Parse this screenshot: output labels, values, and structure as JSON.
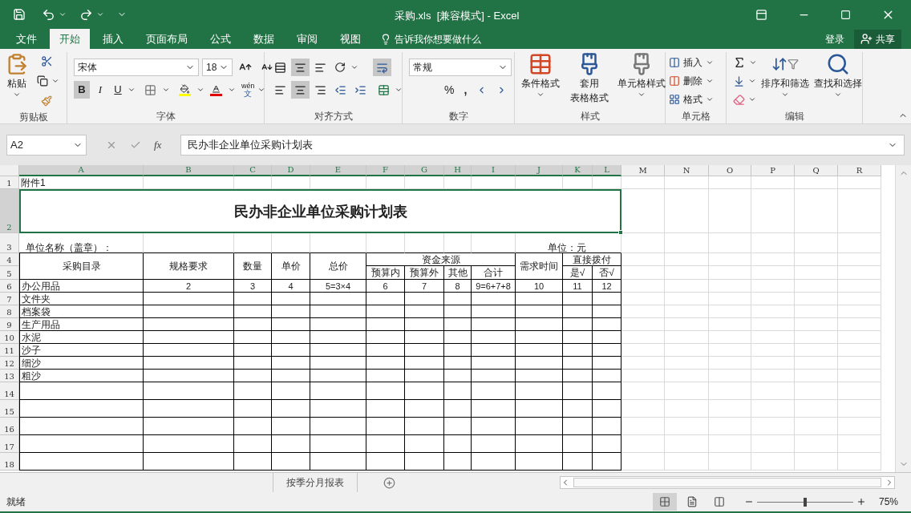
{
  "title_bar": {
    "title": "采购.xls  [兼容模式] - Excel"
  },
  "menu_tabs": [
    {
      "label": "文件",
      "selected": false
    },
    {
      "label": "开始",
      "selected": true
    },
    {
      "label": "插入",
      "selected": false
    },
    {
      "label": "页面布局",
      "selected": false
    },
    {
      "label": "公式",
      "selected": false
    },
    {
      "label": "数据",
      "selected": false
    },
    {
      "label": "审阅",
      "selected": false
    },
    {
      "label": "视图",
      "selected": false
    }
  ],
  "tell_me": "告诉我你想要做什么",
  "sign_in": "登录",
  "share": "共享",
  "ribbon": {
    "clipboard": {
      "paste": "粘贴",
      "group": "剪贴板"
    },
    "font": {
      "name": "宋体",
      "size": "18",
      "bold": "B",
      "italic": "I",
      "underline": "U",
      "phonetic": [
        "wén",
        "文"
      ],
      "group": "字体"
    },
    "alignment": {
      "group": "对齐方式"
    },
    "number": {
      "format": "常规",
      "percent": "%",
      "comma": ",",
      "group": "数字"
    },
    "styles": {
      "conditional": "条件格式",
      "table_format": [
        "套用",
        "表格格式"
      ],
      "cell_styles": "单元格样式",
      "group": "样式"
    },
    "cells": {
      "insert": "插入",
      "delete": "删除",
      "format": "格式",
      "group": "单元格"
    },
    "editing": {
      "sort_filter": "排序和筛选",
      "find_select": "查找和选择",
      "group": "编辑"
    }
  },
  "formula_bar": {
    "name_box": "A2",
    "fx": "fx",
    "content": "民办非企业单位采购计划表"
  },
  "sheet": {
    "columns": [
      {
        "label": "A",
        "selected": true
      },
      {
        "label": "B",
        "selected": true
      },
      {
        "label": "C",
        "selected": true
      },
      {
        "label": "D",
        "selected": true
      },
      {
        "label": "E",
        "selected": true
      },
      {
        "label": "F",
        "selected": true
      },
      {
        "label": "G",
        "selected": true
      },
      {
        "label": "H",
        "selected": true
      },
      {
        "label": "I",
        "selected": true
      },
      {
        "label": "J",
        "selected": true
      },
      {
        "label": "K",
        "selected": true
      },
      {
        "label": "L",
        "selected": true
      },
      {
        "label": "M",
        "selected": false
      },
      {
        "label": "N",
        "selected": false
      },
      {
        "label": "O",
        "selected": false
      },
      {
        "label": "P",
        "selected": false
      },
      {
        "label": "Q",
        "selected": false
      },
      {
        "label": "R",
        "selected": false
      }
    ],
    "row_headers": [
      {
        "label": "1",
        "selected": false
      },
      {
        "label": "2",
        "selected": true
      },
      {
        "label": "3",
        "selected": false
      },
      {
        "label": "4",
        "selected": false
      },
      {
        "label": "5",
        "selected": false
      },
      {
        "label": "6",
        "selected": false
      },
      {
        "label": "7",
        "selected": false
      },
      {
        "label": "8",
        "selected": false
      },
      {
        "label": "9",
        "selected": false
      },
      {
        "label": "10",
        "selected": false
      },
      {
        "label": "11",
        "selected": false
      },
      {
        "label": "12",
        "selected": false
      },
      {
        "label": "13",
        "selected": false
      },
      {
        "label": "14",
        "selected": false
      },
      {
        "label": "15",
        "selected": false
      },
      {
        "label": "16",
        "selected": false
      },
      {
        "label": "17",
        "selected": false
      },
      {
        "label": "18",
        "selected": false
      }
    ],
    "attachment": "附件1",
    "title": "民办非企业单位采购计划表",
    "unit_name_label": "单位名称（盖章）：",
    "unit_label": "单位：元",
    "headers": {
      "catalog": "采购目录",
      "spec": "规格要求",
      "qty": "数量",
      "price": "单价",
      "total": "总价",
      "funding": "资金来源",
      "funding_sub": [
        "预算内",
        "预算外",
        "其他",
        "合计"
      ],
      "time": "需求时间",
      "direct": "直接拨付",
      "direct_sub": [
        "是√",
        "否√"
      ]
    },
    "number_row": [
      "办公用品",
      "2",
      "3",
      "4",
      "5=3×4",
      "6",
      "7",
      "8",
      "9=6+7+8",
      "10",
      "11",
      "12"
    ],
    "items": [
      "文件夹",
      "档案袋",
      "生产用品",
      "水泥",
      "沙子",
      "细沙",
      "粗沙"
    ]
  },
  "sheet_tabs": [
    {
      "label": "按季分月报表",
      "selected": false
    }
  ],
  "status_bar": {
    "status": "就绪",
    "views": [
      {
        "kind": "normal",
        "selected": true
      },
      {
        "kind": "page_layout",
        "selected": false
      },
      {
        "kind": "page_break",
        "selected": false
      }
    ],
    "zoom": {
      "level": 0.5,
      "label": "75%"
    }
  }
}
